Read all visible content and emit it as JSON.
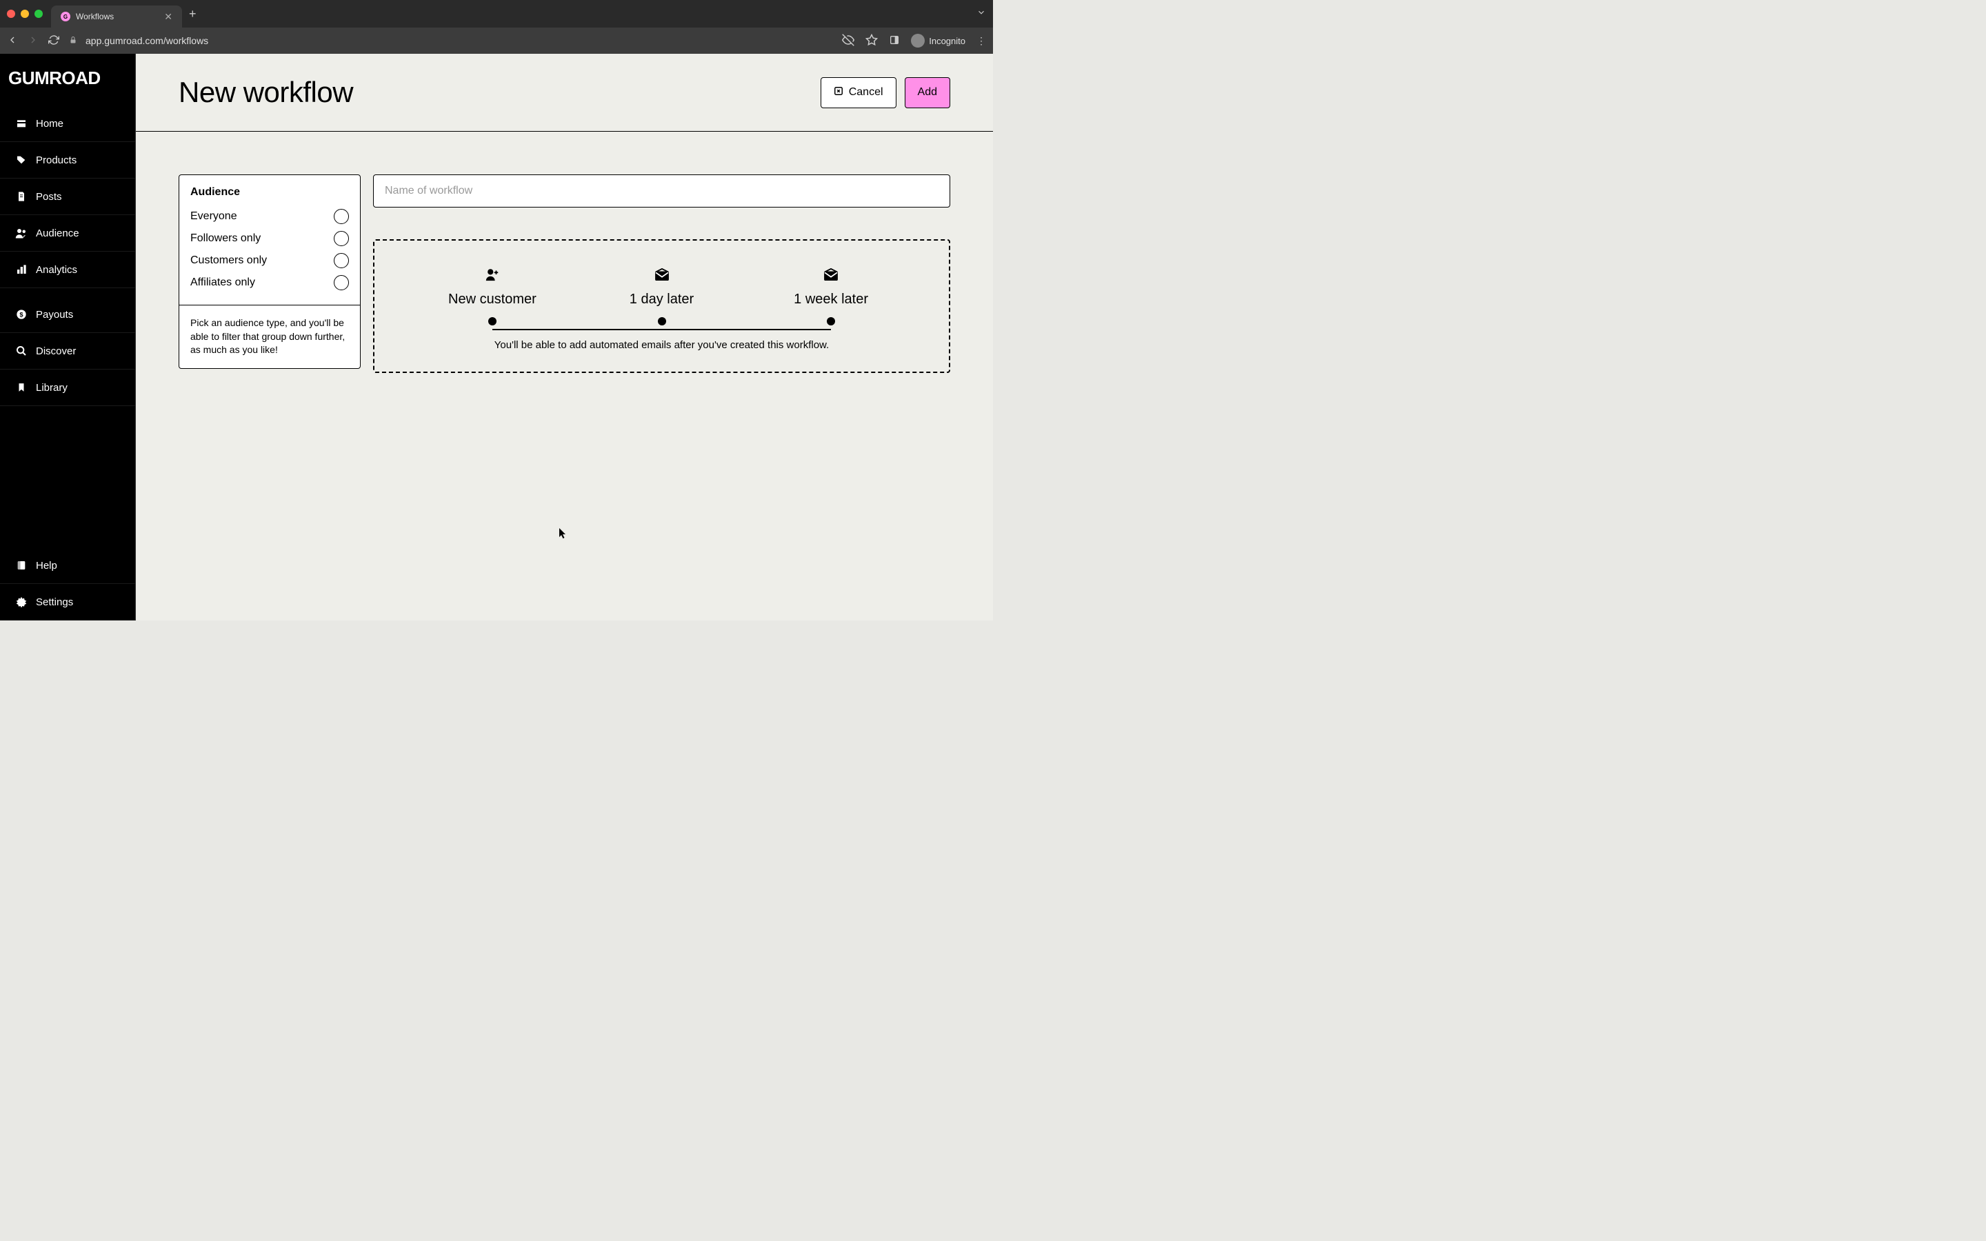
{
  "browser": {
    "tab_title": "Workflows",
    "url": "app.gumroad.com/workflows",
    "profile_label": "Incognito"
  },
  "brand": {
    "logo_text": "GUMROAD"
  },
  "sidebar": {
    "items": [
      {
        "label": "Home",
        "icon": "home-icon"
      },
      {
        "label": "Products",
        "icon": "tag-icon"
      },
      {
        "label": "Posts",
        "icon": "document-icon"
      },
      {
        "label": "Audience",
        "icon": "people-icon"
      },
      {
        "label": "Analytics",
        "icon": "chart-icon"
      }
    ],
    "bottom_items": [
      {
        "label": "Payouts",
        "icon": "dollar-icon"
      },
      {
        "label": "Discover",
        "icon": "search-icon"
      },
      {
        "label": "Library",
        "icon": "bookmark-icon"
      }
    ],
    "footer_items": [
      {
        "label": "Help",
        "icon": "book-icon"
      },
      {
        "label": "Settings",
        "icon": "gear-icon"
      }
    ]
  },
  "header": {
    "title": "New workflow",
    "cancel_label": "Cancel",
    "add_label": "Add"
  },
  "audience": {
    "title": "Audience",
    "options": [
      {
        "label": "Everyone"
      },
      {
        "label": "Followers only"
      },
      {
        "label": "Customers only"
      },
      {
        "label": "Affiliates only"
      }
    ],
    "hint": "Pick an audience type, and you'll be able to filter that group down further, as much as you like!"
  },
  "workflow": {
    "name_placeholder": "Name of workflow",
    "name_value": "",
    "steps": [
      {
        "label": "New customer",
        "icon": "person-plus-icon"
      },
      {
        "label": "1 day later",
        "icon": "envelope-icon"
      },
      {
        "label": "1 week later",
        "icon": "envelope-icon"
      }
    ],
    "preview_hint": "You'll be able to add automated emails after you've created this workflow."
  },
  "colors": {
    "accent": "#ff90e8",
    "bg": "#eeeee9",
    "sidebar": "#000000"
  }
}
